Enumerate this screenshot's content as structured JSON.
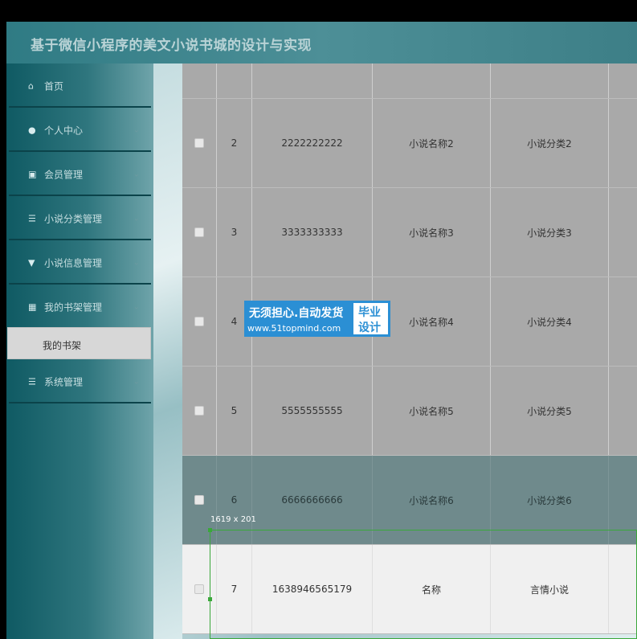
{
  "header": {
    "title": "基于微信小程序的美文小说书城的设计与实现"
  },
  "sidebar": {
    "items": [
      {
        "icon": "home-icon",
        "label": "首页",
        "chevron": ""
      },
      {
        "icon": "user-icon",
        "label": "个人中心",
        "chevron": "⌄"
      },
      {
        "icon": "clipboard-icon",
        "label": "会员管理",
        "chevron": "⌄"
      },
      {
        "icon": "list-icon",
        "label": "小说分类管理",
        "chevron": "⌄"
      },
      {
        "icon": "flag-icon",
        "label": "小说信息管理",
        "chevron": "⌄"
      },
      {
        "icon": "grid-icon",
        "label": "我的书架管理",
        "chevron": "⌄"
      },
      {
        "icon": "list-icon",
        "label": "系统管理",
        "chevron": "⌄"
      }
    ],
    "submenu": {
      "label": "我的书架"
    }
  },
  "table": {
    "rows": [
      {
        "index": "2",
        "id": "2222222222",
        "name": "小说名称2",
        "category": "小说分类2"
      },
      {
        "index": "3",
        "id": "3333333333",
        "name": "小说名称3",
        "category": "小说分类3"
      },
      {
        "index": "4",
        "id": "",
        "name": "小说名称4",
        "category": "小说分类4"
      },
      {
        "index": "5",
        "id": "5555555555",
        "name": "小说名称5",
        "category": "小说分类5"
      },
      {
        "index": "6",
        "id": "6666666666",
        "name": "小说名称6",
        "category": "小说分类6"
      },
      {
        "index": "7",
        "id": "1638946565179",
        "name": "名称",
        "category": "言情小说"
      }
    ]
  },
  "overlay": {
    "selection_size": "1619 x 201"
  },
  "watermark": {
    "line1": "无须担心.自动发货",
    "line2": "www.51topmind.com",
    "badge_top": "毕业",
    "badge_bottom": "设计"
  },
  "colors": {
    "header": "#3d7f87",
    "sidebar": "#0f5a63",
    "hover_row": "#6f8a8c",
    "watermark": "#2b8fd4",
    "selection": "#3aa83a"
  }
}
